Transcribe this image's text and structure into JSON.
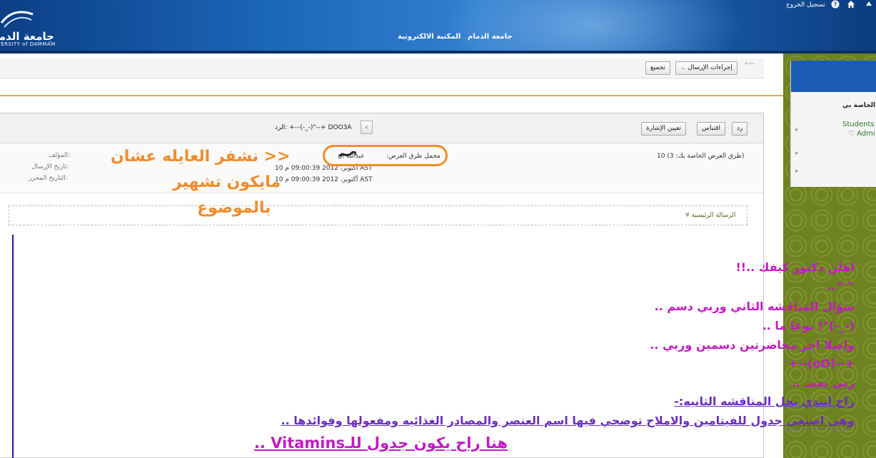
{
  "header": {
    "logo_ar": "جامعة الدمام",
    "logo_en": "UNIVERSITY of DAMMAM",
    "nav": [
      "جامعة الدمام",
      "المكتبة الالكترونية"
    ],
    "logout": "تسجيل الخروج",
    "icons": [
      "help-icon",
      "home-icon",
      "up-icon"
    ]
  },
  "toolbar": {
    "send_actions": "إجراءات الإرسال",
    "collect": "تجميع"
  },
  "thread": {
    "reply_btn": "رد",
    "quote_btn": "اقتباس",
    "flag_btn": "تعيين الإشارة",
    "reply_title": "الرد: +-–(-_-)\"--+ DOO3A",
    "views_total": "10 (طرق العرض الخاصة بك: 3)",
    "views_label": "مجمل طرق العرض:",
    "author_name": "عبدالله ال",
    "date_sent": "10 أكتوبر، 2012 09:00:39 م AST",
    "date_edited": "10 أكتوبر، 2012 09:00:39 م AST",
    "author_label": "المؤلف:",
    "sent_label": "تاريخ الإرسال:",
    "edited_label": "التاريخ المحرر:",
    "main_message": "الرسالة الرئيسية"
  },
  "annotation": {
    "line1": "<< نشفر العايله عشان",
    "line2": "مايكون تشهير",
    "line3": "بالموضوع"
  },
  "message": {
    "l1": "اهلن دكتور كيفك ..!!",
    "l2": "^^..",
    "l3": "سؤال المناقشه الثاني وربي دسم ..",
    "l4": "(-_-)\"! نوعا ما ..",
    "l5": "واصلا اخر محاضرتين دسمين وربي ..",
    "l6": "+--(oO)--+",
    "l7": "ربي يعينـ ..",
    "l8": "راح ابتدي بحل المناقشه الثانيه:-",
    "l9": "وهي اصنعي جدول للفيتامين والاملاح توضحي فيها اسم العنصر والمصادر الغذائيه ومفعولها وفوائدها ..",
    "l10": "هنا راح يكون جدول للـVitamins .."
  },
  "sidepanel": {
    "title": "الخاصة بي",
    "link1": "Students I",
    "link2": "♡ Admi"
  },
  "colors": {
    "header_blue": "#1c65b7",
    "accent_orange": "#f08c2a",
    "message_magenta": "#c21bc2",
    "message_purple": "#6a2ec0",
    "side_green": "#6f8221"
  }
}
